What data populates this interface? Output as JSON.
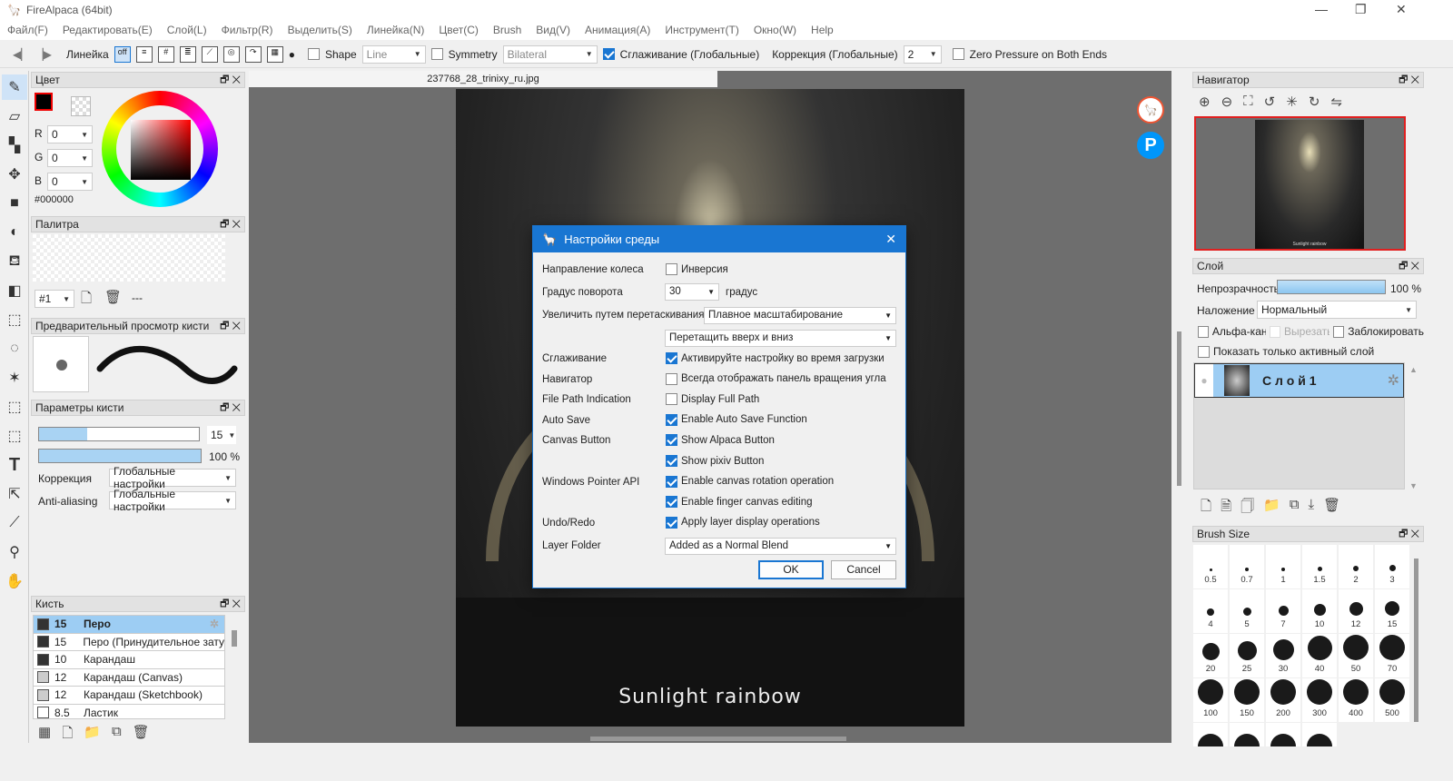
{
  "app": {
    "title": "FireAlpaca (64bit)"
  },
  "menu": [
    "Файл(F)",
    "Редактировать(E)",
    "Слой(L)",
    "Фильтр(R)",
    "Выделить(S)",
    "Линейка(N)",
    "Цвет(C)",
    "Brush",
    "Вид(V)",
    "Анимация(A)",
    "Инструмент(T)",
    "Окно(W)",
    "Help"
  ],
  "toolbar": {
    "ruler_label": "Линейка",
    "ruler_off": "off",
    "shape_label": "Shape",
    "shape_value": "Line",
    "symmetry_label": "Symmetry",
    "symmetry_value": "Bilateral",
    "smoothing_label": "Сглаживание (Глобальные)",
    "smoothing_checked": true,
    "correction_label": "Коррекция (Глобальные)",
    "correction_value": "2",
    "zero_pressure_label": "Zero Pressure on Both Ends"
  },
  "color_panel": {
    "title": "Цвет",
    "r_label": "R",
    "r": "0",
    "g_label": "G",
    "g": "0",
    "b_label": "B",
    "b": "0",
    "hex": "#000000",
    "primary": "#000000",
    "secondary": "#ffffff"
  },
  "palette_panel": {
    "title": "Палитра",
    "index": "#1",
    "name": "---"
  },
  "brush_preview_panel": {
    "title": "Предварительный просмотр кисти"
  },
  "brush_params_panel": {
    "title": "Параметры кисти",
    "size": "15",
    "size_fraction": 0.3,
    "opacity": "100 %",
    "opacity_fraction": 1.0,
    "correction_label": "Коррекция",
    "correction_value": "Глобальные настройки",
    "aa_label": "Anti-aliasing",
    "aa_value": "Глобальные настройки"
  },
  "brush_panel": {
    "title": "Кисть",
    "items": [
      {
        "size": "15",
        "name": "Перо",
        "color": "#333333",
        "selected": true
      },
      {
        "size": "15",
        "name": "Перо (Принудительное зату",
        "color": "#333333"
      },
      {
        "size": "10",
        "name": "Карандаш",
        "color": "#333333"
      },
      {
        "size": "12",
        "name": "Карандаш (Canvas)",
        "color": "#cccccc"
      },
      {
        "size": "12",
        "name": "Карандаш (Sketchbook)",
        "color": "#cccccc"
      },
      {
        "size": "8.5",
        "name": "Ластик",
        "color": "#ffffff"
      }
    ]
  },
  "document": {
    "tab": "237768_28_trinixy_ru.jpg",
    "caption": "Sunlight rainbow"
  },
  "dialog": {
    "title": "Настройки среды",
    "wheel_label": "Направление колеса",
    "wheel_option": "Инверсия",
    "wheel_checked": false,
    "rotation_label": "Градус поворота",
    "rotation_value": "30",
    "rotation_unit": "градус",
    "zoom_label": "Увеличить путем перетаскивания",
    "zoom_value": "Плавное масштабирование",
    "zoom_drag_value": "Перетащить вверх и вниз",
    "rows": [
      {
        "label": "Сглаживание",
        "option": "Активируйте настройку во время загрузки",
        "checked": true
      },
      {
        "label": "Навигатор",
        "option": "Всегда отображать панель вращения угла",
        "checked": false
      },
      {
        "label": "File Path Indication",
        "option": "Display Full Path",
        "checked": false
      },
      {
        "label": "Auto Save",
        "option": "Enable Auto Save Function",
        "checked": true
      },
      {
        "label": "Canvas Button",
        "option": "Show Alpaca Button",
        "checked": true
      },
      {
        "label": "",
        "option": "Show pixiv Button",
        "checked": true
      },
      {
        "label": "Windows Pointer API",
        "option": "Enable canvas rotation operation",
        "checked": true
      },
      {
        "label": "",
        "option": "Enable finger canvas editing",
        "checked": true
      },
      {
        "label": "Undo/Redo",
        "option": "Apply layer display operations",
        "checked": true
      }
    ],
    "folder_label": "Layer Folder",
    "folder_value": "Added as a Normal Blend",
    "ok": "OK",
    "cancel": "Cancel"
  },
  "navigator": {
    "title": "Навигатор",
    "thumb_caption": "Sunlight rainbow"
  },
  "layer_panel": {
    "title": "Слой",
    "opacity_label": "Непрозрачность",
    "opacity": "100 %",
    "opacity_fraction": 1.0,
    "blend_label": "Наложение",
    "blend_value": "Нормальный",
    "alpha": "Альфа-кана.",
    "clip": "Вырезать",
    "lock": "Заблокировать",
    "only_active": "Показать только активный слой",
    "layers": [
      {
        "name": "С л о й 1"
      }
    ]
  },
  "brush_size_panel": {
    "title": "Brush Size",
    "sizes": [
      "0.5",
      "0.7",
      "1",
      "1.5",
      "2",
      "3",
      "4",
      "5",
      "7",
      "10",
      "12",
      "15",
      "20",
      "25",
      "30",
      "40",
      "50",
      "70",
      "100",
      "150",
      "200",
      "300",
      "400",
      "500",
      "",
      "",
      "",
      ""
    ]
  }
}
